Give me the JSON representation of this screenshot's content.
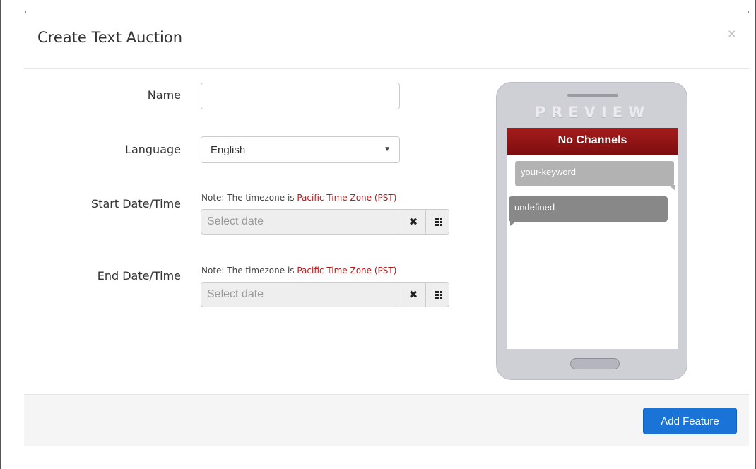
{
  "modal": {
    "title": "Create Text Auction",
    "close_symbol": "×"
  },
  "form": {
    "name_label": "Name",
    "name_value": "",
    "language_label": "Language",
    "language_value": "English",
    "start_label": "Start Date/Time",
    "end_label": "End Date/Time",
    "timezone_note_prefix": "Note: The timezone is ",
    "timezone_name": "Pacific Time Zone (PST)",
    "date_placeholder": "Select date",
    "clear_symbol": "✖"
  },
  "preview": {
    "header": "PREVIEW",
    "channel": "No Channels",
    "outgoing_message": "your-keyword",
    "incoming_message": "undefined"
  },
  "footer": {
    "add_feature_label": "Add Feature"
  },
  "colors": {
    "accent_button": "#1a73d6",
    "channel_bar": "#9a1717",
    "timezone_text": "#b01c1c"
  },
  "icons": {
    "close": "close-icon",
    "clear": "clear-date-icon",
    "calendar": "calendar-grid-icon",
    "dropdown": "chevron-down-icon"
  }
}
